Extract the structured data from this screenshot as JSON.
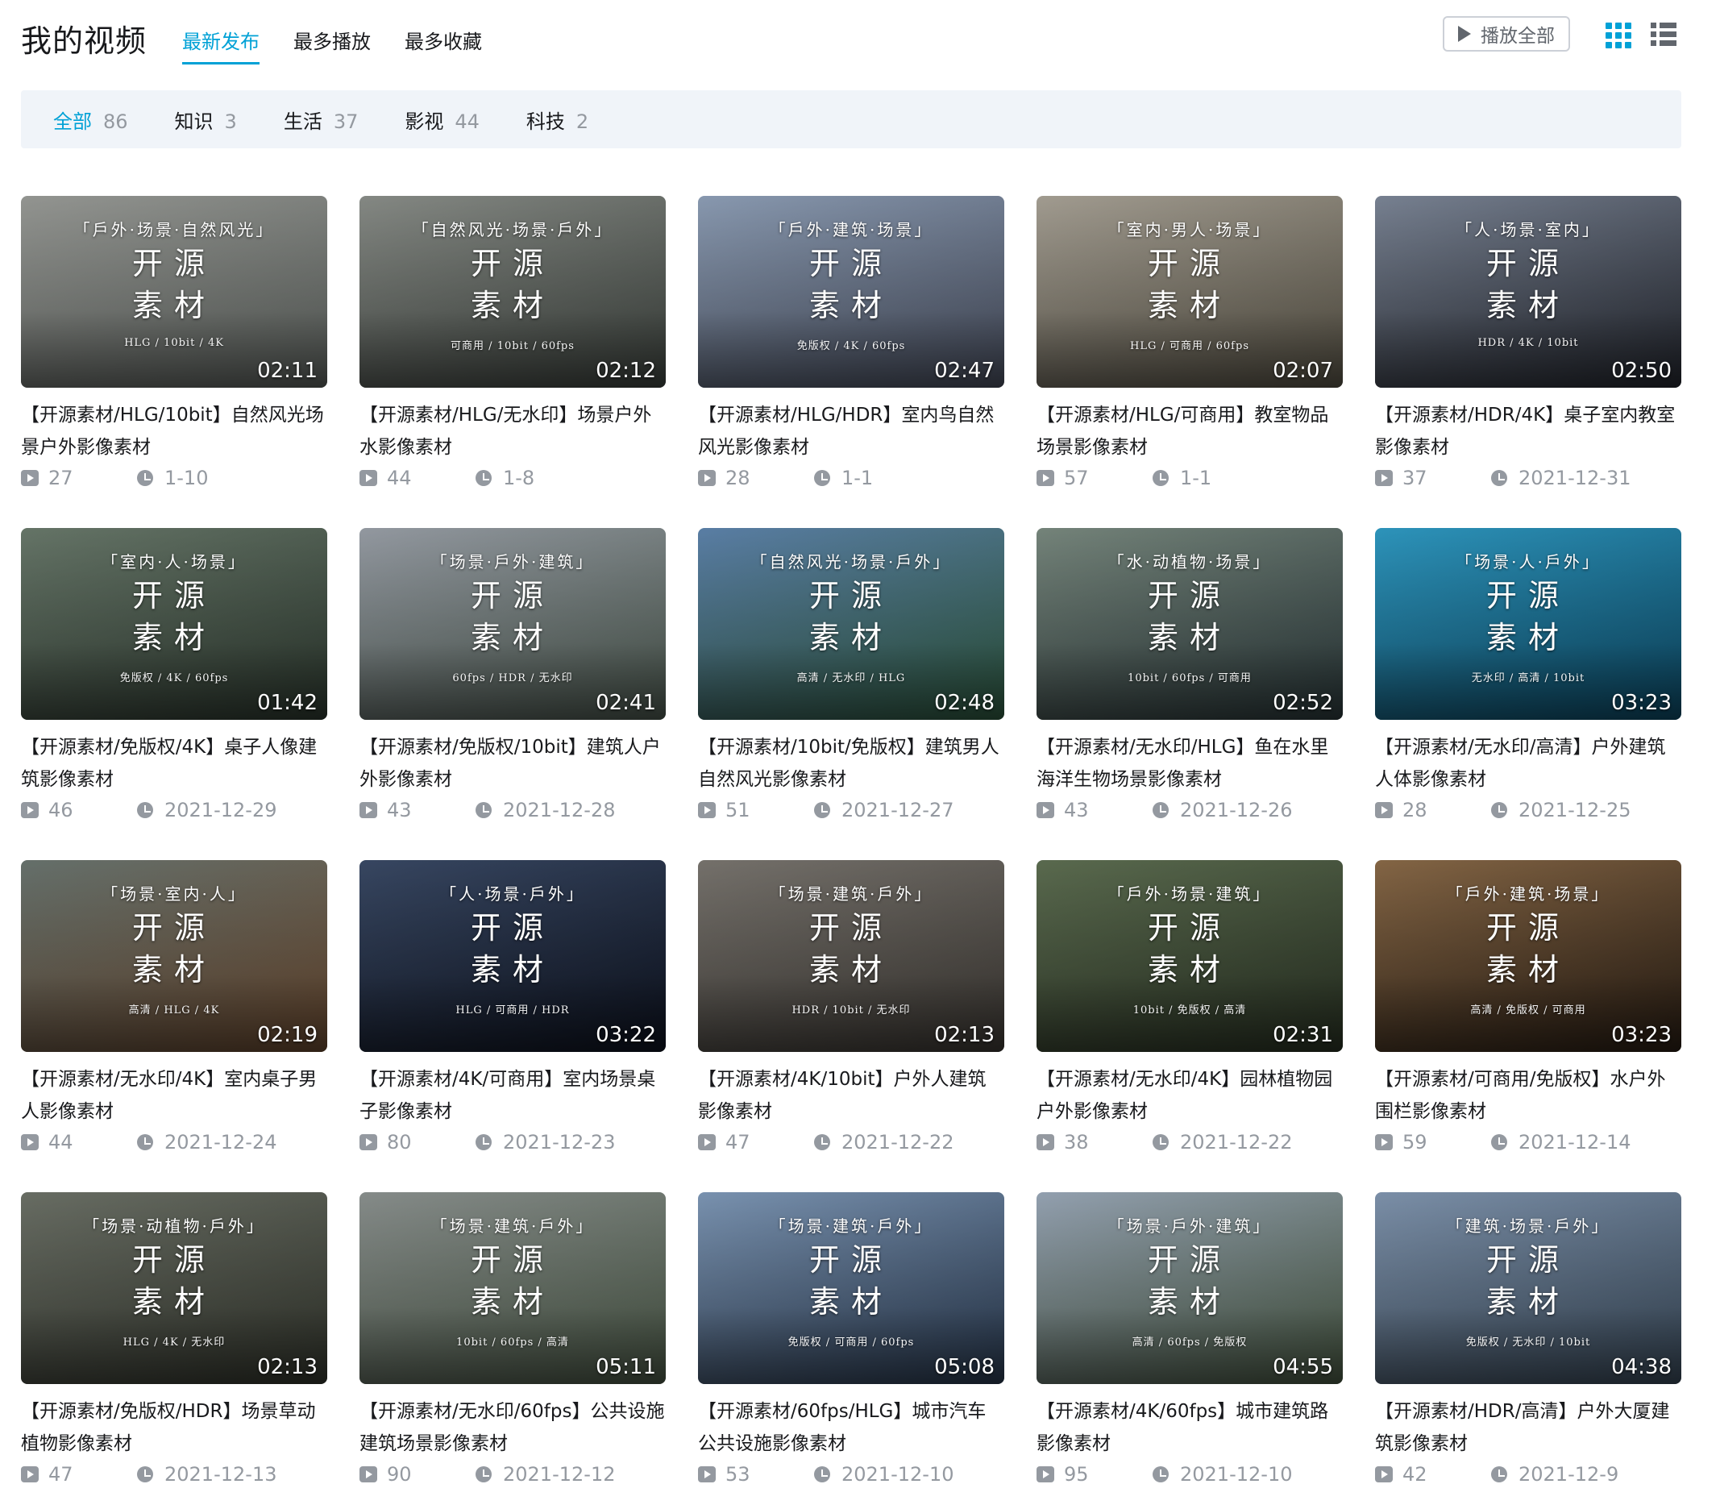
{
  "header": {
    "title": "我的视频",
    "tabs": [
      "最新发布",
      "最多播放",
      "最多收藏"
    ],
    "play_all_label": "播放全部"
  },
  "filters": [
    {
      "label": "全部",
      "count": "86"
    },
    {
      "label": "知识",
      "count": "3"
    },
    {
      "label": "生活",
      "count": "37"
    },
    {
      "label": "影视",
      "count": "44"
    },
    {
      "label": "科技",
      "count": "2"
    }
  ],
  "videos": [
    {
      "title": "【开源素材/HLG/10bit】自然风光场景户外影像素材",
      "plays": "27",
      "date": "1-10",
      "duration": "02:11",
      "tags": "「戶外·场景·自然风光」",
      "big1": "开源",
      "big2": "素材",
      "specs": "HLG / 10bit / 4K",
      "colors": [
        "#9a9c98",
        "#5f6460"
      ]
    },
    {
      "title": "【开源素材/HLG/无水印】场景户外水影像素材",
      "plays": "44",
      "date": "1-8",
      "duration": "02:12",
      "tags": "「自然风光·场景·戶外」",
      "big1": "开源",
      "big2": "素材",
      "specs": "可商用 / 10bit / 60fps",
      "colors": [
        "#8b8f8a",
        "#3f4540"
      ]
    },
    {
      "title": "【开源素材/HLG/HDR】室内鸟自然风光影像素材",
      "plays": "28",
      "date": "1-1",
      "duration": "02:47",
      "tags": "「戶外·建筑·场景」",
      "big1": "开源",
      "big2": "素材",
      "specs": "免版权 / 4K / 60fps",
      "colors": [
        "#8fa0b8",
        "#4a5060"
      ]
    },
    {
      "title": "【开源素材/HLG/可商用】教室物品场景影像素材",
      "plays": "57",
      "date": "1-1",
      "duration": "02:07",
      "tags": "「室内·男人·场景」",
      "big1": "开源",
      "big2": "素材",
      "specs": "HLG / 可商用 / 60fps",
      "colors": [
        "#a9a397",
        "#5a5548"
      ]
    },
    {
      "title": "【开源素材/HDR/4K】桌子室内教室影像素材",
      "plays": "37",
      "date": "2021-12-31",
      "duration": "02:50",
      "tags": "「人·场景·室内」",
      "big1": "开源",
      "big2": "素材",
      "specs": "HDR / 4K / 10bit",
      "colors": [
        "#7d8798",
        "#252830"
      ]
    },
    {
      "title": "【开源素材/免版权/4K】桌子人像建筑影像素材",
      "plays": "46",
      "date": "2021-12-29",
      "duration": "01:42",
      "tags": "「室内·人·场景」",
      "big1": "开源",
      "big2": "素材",
      "specs": "免版权 / 4K / 60fps",
      "colors": [
        "#6a7a6c",
        "#2e3a30"
      ]
    },
    {
      "title": "【开源素材/免版权/10bit】建筑人户外影像素材",
      "plays": "43",
      "date": "2021-12-28",
      "duration": "02:41",
      "tags": "「场景·戶外·建筑」",
      "big1": "开源",
      "big2": "素材",
      "specs": "60fps / HDR / 无水印",
      "colors": [
        "#9aa0a8",
        "#4d5a50"
      ]
    },
    {
      "title": "【开源素材/10bit/免版权】建筑男人自然风光影像素材",
      "plays": "51",
      "date": "2021-12-27",
      "duration": "02:48",
      "tags": "「自然风光·场景·戶外」",
      "big1": "开源",
      "big2": "素材",
      "specs": "高清 / 无水印 / HLG",
      "colors": [
        "#5e84ad",
        "#2f5a40"
      ]
    },
    {
      "title": "【开源素材/无水印/HLG】鱼在水里海洋生物场景影像素材",
      "plays": "43",
      "date": "2021-12-26",
      "duration": "02:52",
      "tags": "「水·动植物·场景」",
      "big1": "开源",
      "big2": "素材",
      "specs": "10bit / 60fps / 可商用",
      "colors": [
        "#7a8a80",
        "#2c3a3c"
      ]
    },
    {
      "title": "【开源素材/无水印/高清】户外建筑人体影像素材",
      "plays": "28",
      "date": "2021-12-25",
      "duration": "03:23",
      "tags": "「场景·人·戶外」",
      "big1": "开源",
      "big2": "素材",
      "specs": "无水印 / 高清 / 10bit",
      "colors": [
        "#2f9bc4",
        "#0d4a66"
      ]
    },
    {
      "title": "【开源素材/无水印/4K】室内桌子男人影像素材",
      "plays": "44",
      "date": "2021-12-24",
      "duration": "02:19",
      "tags": "「场景·室内·人」",
      "big1": "开源",
      "big2": "素材",
      "specs": "高清 / HLG / 4K",
      "colors": [
        "#6a7570",
        "#6b4a30"
      ]
    },
    {
      "title": "【开源素材/4K/可商用】室内场景桌子影像素材",
      "plays": "80",
      "date": "2021-12-23",
      "duration": "03:22",
      "tags": "「人·场景·戶外」",
      "big1": "开源",
      "big2": "素材",
      "specs": "HLG / 可商用 / HDR",
      "colors": [
        "#3a4a66",
        "#0e1320"
      ]
    },
    {
      "title": "【开源素材/4K/10bit】户外人建筑影像素材",
      "plays": "47",
      "date": "2021-12-22",
      "duration": "02:13",
      "tags": "「场景·建筑·戶外」",
      "big1": "开源",
      "big2": "素材",
      "specs": "HDR / 10bit / 无水印",
      "colors": [
        "#7a7670",
        "#3e3a35"
      ]
    },
    {
      "title": "【开源素材/无水印/4K】园林植物园户外影像素材",
      "plays": "38",
      "date": "2021-12-22",
      "duration": "02:31",
      "tags": "「戶外·场景·建筑」",
      "big1": "开源",
      "big2": "素材",
      "specs": "10bit / 免版权 / 高清",
      "colors": [
        "#5e6f52",
        "#2a3324"
      ]
    },
    {
      "title": "【开源素材/可商用/免版权】水户外围栏影像素材",
      "plays": "59",
      "date": "2021-12-14",
      "duration": "03:23",
      "tags": "「戶外·建筑·场景」",
      "big1": "开源",
      "big2": "素材",
      "specs": "高清 / 免版权 / 可商用",
      "colors": [
        "#8a6a48",
        "#2a1e14"
      ]
    },
    {
      "title": "【开源素材/免版权/HDR】场景草动植物影像素材",
      "plays": "47",
      "date": "2021-12-13",
      "duration": "02:13",
      "tags": "「场景·动植物·戶外」",
      "big1": "开源",
      "big2": "素材",
      "specs": "HLG / 4K / 无水印",
      "colors": [
        "#6d7268",
        "#34372e"
      ]
    },
    {
      "title": "【开源素材/无水印/60fps】公共设施建筑场景影像素材",
      "plays": "90",
      "date": "2021-12-12",
      "duration": "05:11",
      "tags": "「场景·建筑·戶外」",
      "big1": "开源",
      "big2": "素材",
      "specs": "10bit / 60fps / 高清",
      "colors": [
        "#8c9290",
        "#4c5a48"
      ]
    },
    {
      "title": "【开源素材/60fps/HLG】城市汽车公共设施影像素材",
      "plays": "53",
      "date": "2021-12-10",
      "duration": "05:08",
      "tags": "「场景·建筑·戶外」",
      "big1": "开源",
      "big2": "素材",
      "specs": "免版权 / 可商用 / 60fps",
      "colors": [
        "#7f99b8",
        "#2a3a50"
      ]
    },
    {
      "title": "【开源素材/4K/60fps】城市建筑路影像素材",
      "plays": "95",
      "date": "2021-12-10",
      "duration": "04:55",
      "tags": "「场景·戶外·建筑」",
      "big1": "开源",
      "big2": "素材",
      "specs": "高清 / 60fps / 免版权",
      "colors": [
        "#9aa8b8",
        "#4a5a44"
      ]
    },
    {
      "title": "【开源素材/HDR/高清】户外大厦建筑影像素材",
      "plays": "42",
      "date": "2021-12-9",
      "duration": "04:38",
      "tags": "「建筑·场景·戶外」",
      "big1": "开源",
      "big2": "素材",
      "specs": "免版权 / 无水印 / 10bit",
      "colors": [
        "#8196b0",
        "#3a4a5a"
      ]
    }
  ]
}
